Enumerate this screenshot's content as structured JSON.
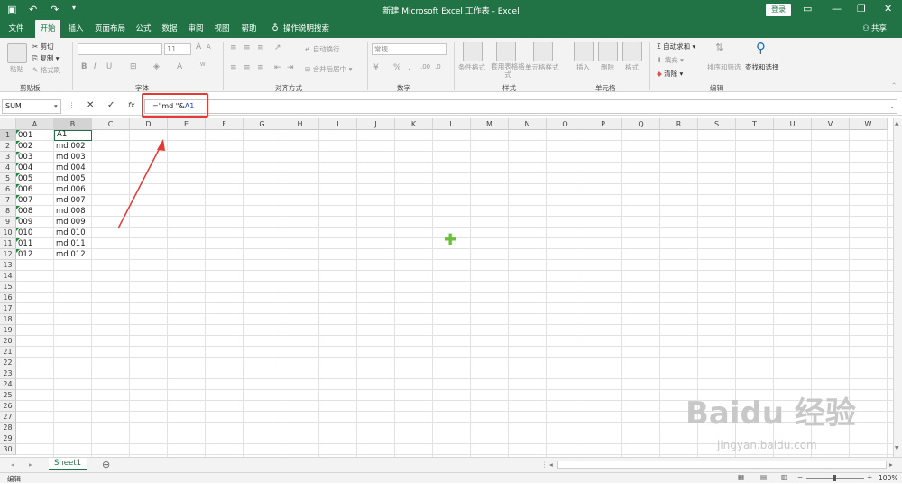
{
  "titlebar": {
    "title": "新建 Microsoft Excel 工作表 - Excel",
    "login": "登录"
  },
  "menu": {
    "tabs": [
      "文件",
      "开始",
      "插入",
      "页面布局",
      "公式",
      "数据",
      "审阅",
      "视图",
      "帮助"
    ],
    "search": "操作说明搜索",
    "share": "共享"
  },
  "ribbon": {
    "clipboard": {
      "paste": "粘贴",
      "cut": "剪切",
      "copy": "复制",
      "format_painter": "格式刷",
      "label": "剪贴板"
    },
    "font": {
      "size": "11",
      "label": "字体"
    },
    "alignment": {
      "wrap": "自动换行",
      "merge": "合并后居中",
      "label": "对齐方式"
    },
    "number": {
      "format": "常规",
      "label": "数字"
    },
    "styles": {
      "conditional": "条件格式",
      "table": "套用表格格式",
      "cell": "单元格样式",
      "label": "样式"
    },
    "cells": {
      "insert": "插入",
      "delete": "删除",
      "format": "格式",
      "label": "单元格"
    },
    "editing": {
      "autosum": "自动求和",
      "fill": "填充",
      "clear": "清除",
      "sort": "排序和筛选",
      "find": "查找和选择",
      "label": "编辑"
    }
  },
  "formula_bar": {
    "name_box": "SUM",
    "fx": "fx",
    "formula_prefix": "=\"md \"&",
    "formula_ref": "A1"
  },
  "grid": {
    "columns": [
      "A",
      "B",
      "C",
      "D",
      "E",
      "F",
      "G",
      "H",
      "I",
      "J",
      "K",
      "L",
      "M",
      "N",
      "O",
      "P",
      "Q",
      "R",
      "S",
      "T",
      "U",
      "V",
      "W"
    ],
    "rows": [
      "1",
      "2",
      "3",
      "4",
      "5",
      "6",
      "7",
      "8",
      "9",
      "10",
      "11",
      "12",
      "13",
      "14",
      "15",
      "16",
      "17",
      "18",
      "19",
      "20",
      "21",
      "22",
      "23",
      "24",
      "25",
      "26",
      "27",
      "28",
      "29",
      "30"
    ],
    "col_a": [
      "001",
      "002",
      "003",
      "004",
      "005",
      "006",
      "007",
      "008",
      "009",
      "010",
      "011",
      "012"
    ],
    "col_b": [
      "A1",
      "md 002",
      "md 003",
      "md 004",
      "md 005",
      "md 006",
      "md 007",
      "md 008",
      "md 009",
      "md 010",
      "md 011",
      "md 012"
    ]
  },
  "sheets": {
    "active": "Sheet1"
  },
  "status": {
    "mode": "编辑",
    "zoom": "100%"
  },
  "watermark": {
    "brand": "Baidu 经验",
    "url": "jingyan.baidu.com"
  },
  "colors": {
    "accent": "#217346",
    "highlight": "#e53935",
    "ref_blue": "#1f4fd1"
  }
}
